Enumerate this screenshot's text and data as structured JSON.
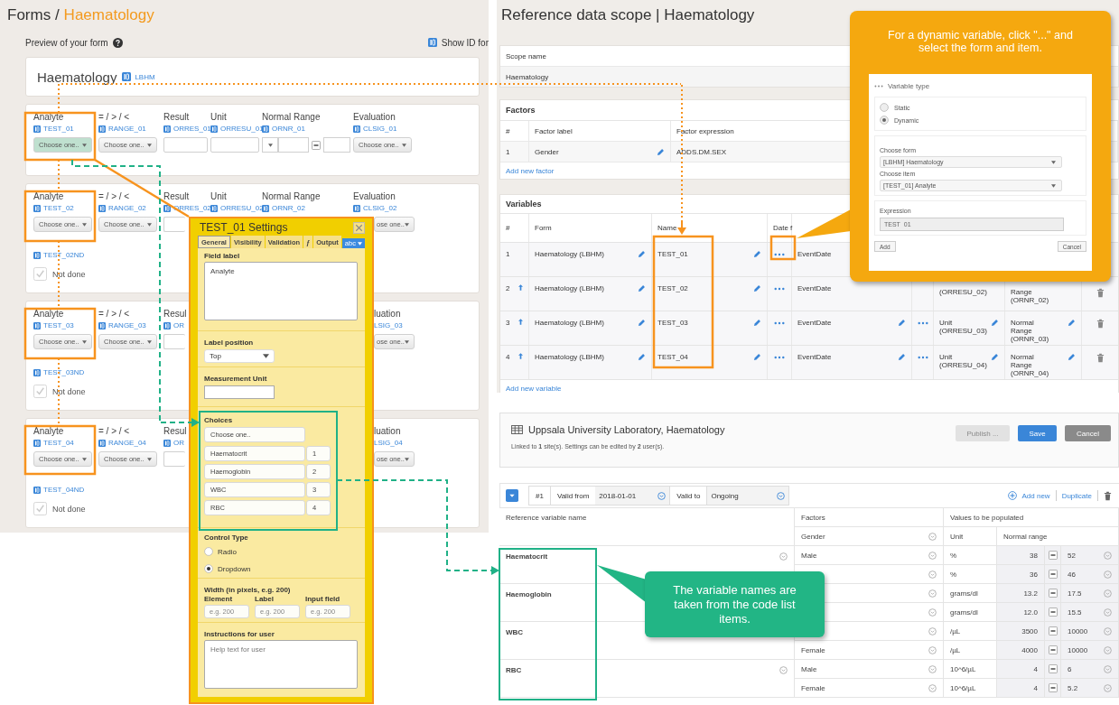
{
  "forms_panel": {
    "breadcrumb": {
      "parent": "Forms /",
      "current": "Haematology"
    },
    "preview_label": "Preview of your form",
    "show_id_label": "Show ID for",
    "form_title": "Haematology",
    "form_id": "LBHM",
    "rows": [
      {
        "kind": "open",
        "analyte": {
          "label": "Analyte",
          "id": "TEST_01",
          "value": "Choose one..",
          "selected": true
        },
        "range": {
          "label": "= / > / <",
          "id": "RANGE_01",
          "value": "Choose one.."
        },
        "result": {
          "label": "Result",
          "id": "ORRES_01"
        },
        "unit": {
          "label": "Unit",
          "id": "ORRESU_01"
        },
        "normal_range": {
          "label": "Normal Range",
          "id": "ORNR_01"
        },
        "evaluation": {
          "label": "Evaluation",
          "id": "CLSIG_01",
          "value": "Choose one.."
        }
      },
      {
        "kind": "partly_covered",
        "analyte": {
          "label": "Analyte",
          "id": "TEST_02",
          "value": "Choose one..",
          "selected": false
        },
        "range": {
          "label": "= / > / <",
          "id": "RANGE_02",
          "value": "Choose one.."
        },
        "result": {
          "label": "Result",
          "id": "ORRES_02"
        },
        "unit": {
          "label": "Unit",
          "id": "ORRESU_02"
        },
        "normal_range": {
          "label": "Normal Range",
          "id": "ORNR_02"
        },
        "evaluation": {
          "label": "Evaluation",
          "id": "CLSIG_02",
          "value": "ose one.."
        },
        "not_done": {
          "id": "TEST_02ND",
          "label": "Not done",
          "checked": true
        }
      },
      {
        "kind": "covered",
        "analyte": {
          "label": "Analyte",
          "id": "TEST_03",
          "value": "Choose one..",
          "selected": false
        },
        "range": {
          "label": "= / > / <",
          "id": "RANGE_03",
          "value": "Choose one.."
        },
        "result": {
          "label": "Resul",
          "id": "OR"
        },
        "evaluation": {
          "label": "luation",
          "id": "LSIG_03",
          "value": "ose one.."
        },
        "not_done": {
          "id": "TEST_03ND",
          "label": "Not done",
          "checked": true
        }
      },
      {
        "kind": "covered",
        "analyte": {
          "label": "Analyte",
          "id": "TEST_04",
          "value": "Choose one..",
          "selected": false
        },
        "range": {
          "label": "= / > / <",
          "id": "RANGE_04",
          "value": "Choose one.."
        },
        "result": {
          "label": "Resul",
          "id": "OR"
        },
        "evaluation": {
          "label": "luation",
          "id": "LSIG_04",
          "value": "ose one.."
        },
        "not_done": {
          "id": "TEST_04ND",
          "label": "Not done",
          "checked": true
        }
      }
    ]
  },
  "settings_dialog": {
    "title": "TEST_01 Settings",
    "tabs": [
      {
        "label": "General",
        "selected": true
      },
      {
        "label": "Visibility",
        "selected": false
      },
      {
        "label": "Validation",
        "selected": false
      },
      {
        "label": "ƒ",
        "selected": false
      },
      {
        "label": "Output",
        "selected": false
      }
    ],
    "format_button": "abc",
    "field_label": {
      "label": "Field label",
      "value": "Analyte"
    },
    "label_position": {
      "label": "Label position",
      "value": "Top"
    },
    "measurement_unit": {
      "label": "Measurement Unit"
    },
    "choices": {
      "label": "Choices",
      "items": [
        {
          "text": "Choose one.."
        },
        {
          "text": "Haematocrit",
          "value": "1"
        },
        {
          "text": "Haemoglobin",
          "value": "2"
        },
        {
          "text": "WBC",
          "value": "3"
        },
        {
          "text": "RBC",
          "value": "4"
        }
      ]
    },
    "control_type": {
      "label": "Control Type",
      "options": [
        {
          "label": "Radio",
          "selected": false
        },
        {
          "label": "Dropdown",
          "selected": true
        }
      ]
    },
    "width": {
      "label": "Width (in pixels, e.g. 200)",
      "fields": [
        {
          "label": "Element",
          "placeholder": "e.g. 200"
        },
        {
          "label": "Label",
          "placeholder": "e.g. 200"
        },
        {
          "label": "Input field",
          "placeholder": "e.g. 200"
        }
      ]
    },
    "instructions": {
      "label": "Instructions for user",
      "placeholder": "Help text for user"
    }
  },
  "scope_panel": {
    "title": "Reference data scope | Haematology",
    "scope_name": {
      "label": "Scope name",
      "value": "Haematology"
    },
    "factors": {
      "title": "Factors",
      "columns": [
        "#",
        "Factor label",
        "Factor expression"
      ],
      "rows": [
        {
          "number": "1",
          "label": "Gender",
          "expression": "ADDS.DM.SEX"
        }
      ],
      "add_link": "Add new factor"
    },
    "variables": {
      "title": "Variables",
      "columns": [
        "#",
        "Form",
        "Name",
        "Date f"
      ],
      "rows": [
        {
          "kind": "covered",
          "number": "1",
          "form": "Haematology (LBHM)",
          "name": "TEST_01",
          "date": "EventDate"
        },
        {
          "kind": "partly_covered",
          "number": "2",
          "form": "Haematology (LBHM)",
          "name": "TEST_02",
          "date": "EventDate",
          "unit": "(ORRESU_02)",
          "normal_range": "Range (ORNR_02)"
        },
        {
          "kind": "open",
          "number": "3",
          "form": "Haematology (LBHM)",
          "name": "TEST_03",
          "date": "EventDate",
          "unit": "Unit (ORRESU_03)",
          "normal_range": "Normal Range (ORNR_03)"
        },
        {
          "kind": "open",
          "number": "4",
          "form": "Haematology (LBHM)",
          "name": "TEST_04",
          "date": "EventDate",
          "unit": "Unit (ORRESU_04)",
          "normal_range": "Normal Range (ORNR_04)"
        }
      ],
      "add_link": "Add new variable"
    }
  },
  "variable_type_callout": {
    "text": "For a dynamic variable, click \"...\" and select the form and item.",
    "title": "Variable type",
    "options": [
      {
        "label": "Static",
        "selected": false
      },
      {
        "label": "Dynamic",
        "selected": true
      }
    ],
    "choose_form": {
      "label": "Choose form",
      "value": "[LBHM] Haematology"
    },
    "choose_item": {
      "label": "Choose item",
      "value": "[TEST_01] Analyte"
    },
    "expression": {
      "label": "Expression",
      "value": "TEST_01"
    },
    "buttons": [
      "Add",
      "Cancel"
    ]
  },
  "lab_panel": {
    "title": "Uppsala University Laboratory, Haematology",
    "subtitle": "Linked to **1** site(s). Settings can be edited by **2** user(s).",
    "buttons": [
      {
        "label": "Publish ...",
        "kind": "disabled"
      },
      {
        "label": "Save",
        "kind": "primary"
      },
      {
        "label": "Cancel",
        "kind": "secondary"
      }
    ],
    "period": {
      "number": "#1",
      "valid_from_label": "Valid from",
      "valid_from": "2018-01-01",
      "valid_to_label": "Valid to",
      "valid_to": "Ongoing"
    },
    "add_new": "Add new",
    "duplicate": "Duplicate",
    "table": {
      "headers": [
        "Reference variable name",
        "Factors",
        "Values to be populated"
      ],
      "subheaders": [
        "Gender",
        "Unit",
        "Normal range"
      ],
      "variables": [
        {
          "name": "Haematocrit",
          "values": [
            {
              "gender": "Male",
              "unit": "%",
              "low": "38",
              "high": "52"
            },
            {
              "unit": "%",
              "low": "36",
              "high": "46"
            }
          ]
        },
        {
          "name": "Haemoglobin",
          "values": [
            {
              "unit": "grams/dl",
              "low": "13.2",
              "high": "17.5"
            },
            {
              "unit": "grams/dl",
              "low": "12.0",
              "high": "15.5"
            }
          ]
        },
        {
          "name": "WBC",
          "values": [
            {
              "unit": "/µL",
              "low": "3500",
              "high": "10000"
            },
            {
              "gender": "Female",
              "unit": "/µL",
              "low": "4000",
              "high": "10000"
            }
          ]
        },
        {
          "name": "RBC",
          "values": [
            {
              "gender": "Male",
              "unit": "10^6/µL",
              "low": "4",
              "high": "6"
            },
            {
              "gender": "Female",
              "unit": "10^6/µL",
              "low": "4",
              "high": "5.2"
            }
          ]
        }
      ]
    }
  },
  "variable_names_callout": {
    "text": "The variable names are taken from the code list items."
  }
}
